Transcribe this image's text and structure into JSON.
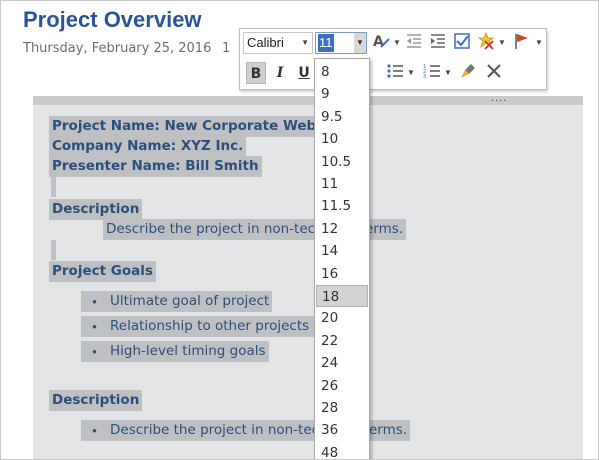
{
  "header": {
    "title": "Project Overview",
    "date": "Thursday, February 25, 2016",
    "time": "1"
  },
  "content": {
    "handle_dots": "....",
    "project_name": "Project Name: New Corporate Website",
    "company_name": "Company Name: XYZ Inc.",
    "presenter_name": "Presenter Name: Bill Smith",
    "description_heading_1": "Description",
    "description_text_1": "Describe the project in non-technical terms.",
    "goals_heading": "Project Goals",
    "goals": [
      "Ultimate goal of project",
      "Relationship to other projects",
      "High-level timing goals"
    ],
    "description_heading_2": "Description",
    "description_text_2": "Describe the project in non-technical terms.",
    "bullet_glyph": "•"
  },
  "toolbar": {
    "font_name": "Calibri",
    "font_size": "11",
    "bold_label": "B",
    "italic_label": "I",
    "underline_label": "U",
    "dropdown_arrow": "▼"
  },
  "font_size_list": {
    "options": [
      "8",
      "9",
      "9.5",
      "10",
      "10.5",
      "11",
      "11.5",
      "12",
      "14",
      "16",
      "18",
      "20",
      "22",
      "24",
      "26",
      "28",
      "36",
      "48"
    ],
    "highlighted": "18"
  },
  "colors": {
    "title": "#2e5395",
    "text": "#2c4f7b",
    "selection": "#bfc0c3",
    "accent": "#3f6fbd"
  }
}
